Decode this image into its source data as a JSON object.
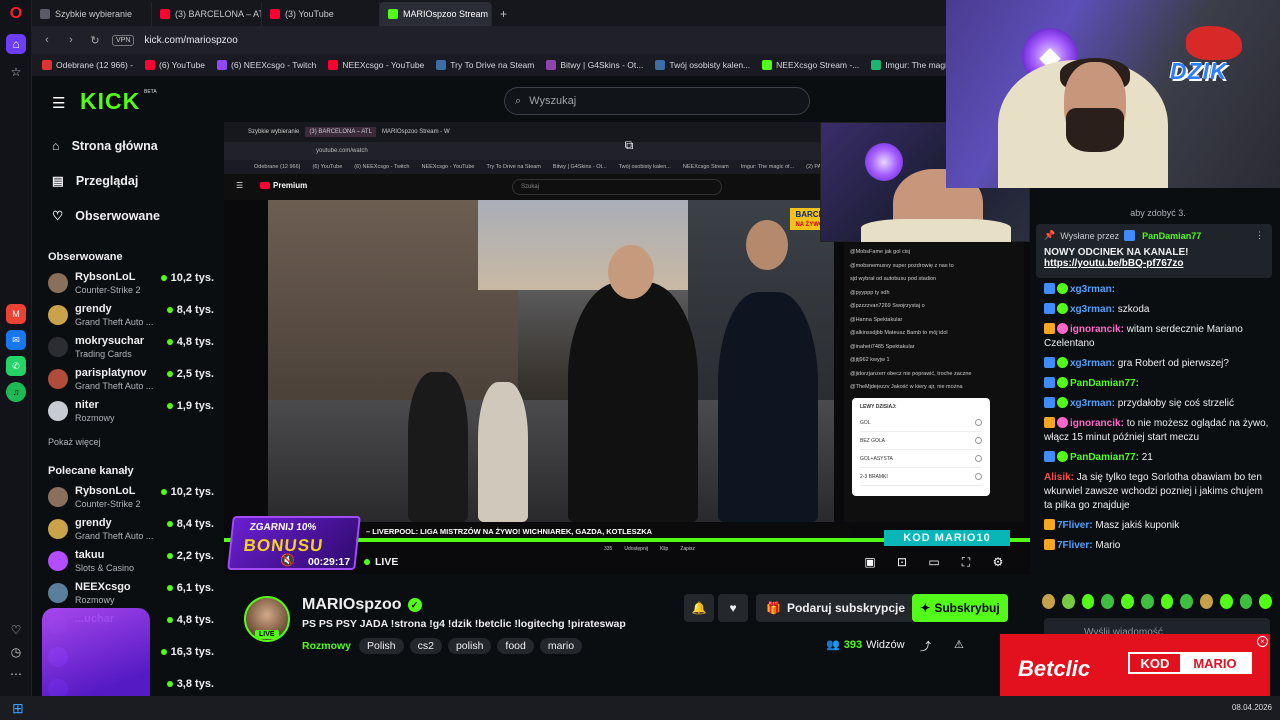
{
  "browser": {
    "tabs": [
      {
        "label": "Szybkie wybieranie",
        "color": "#5a5a66"
      },
      {
        "label": "(3) BARCELONA – ATL",
        "color": "#ff0033"
      },
      {
        "label": "(3) YouTube",
        "color": "#ff0033"
      },
      {
        "label": "MARIOspzoo Stream - W",
        "color": "#53fc18"
      }
    ],
    "new_tab": "+",
    "vpn": "VPN",
    "url": "kick.com/mariospzoo",
    "bookmarks": [
      {
        "label": "Odebrane (12 966) -",
        "color": "#d33"
      },
      {
        "label": "(6) YouTube",
        "color": "#ff0033"
      },
      {
        "label": "(6) NEEXcsgo - Twitch",
        "color": "#9146ff"
      },
      {
        "label": "NEEXcsgo - YouTube",
        "color": "#ff0033"
      },
      {
        "label": "Try To Drive na Steam",
        "color": "#3a6ea5"
      },
      {
        "label": "Bitwy | G4Skins - Ot...",
        "color": "#8e44ad"
      },
      {
        "label": "Twój osobisty kalen...",
        "color": "#3a6ea5"
      },
      {
        "label": "NEEXcsgo Stream -...",
        "color": "#53fc18"
      },
      {
        "label": "Imgur: The magic of...",
        "color": "#1bb76e"
      },
      {
        "label": "(2) PASI",
        "color": "#ff0033"
      }
    ]
  },
  "kick": {
    "logo": "KICK",
    "beta": "BETA",
    "search_placeholder": "Wyszukaj",
    "nav": [
      {
        "label": "Strona główna",
        "icon": "home-icon",
        "glyph": "⌂"
      },
      {
        "label": "Przeglądaj",
        "icon": "browse-icon",
        "glyph": "▤"
      },
      {
        "label": "Obserwowane",
        "icon": "heart-icon",
        "glyph": "♡"
      }
    ],
    "followed_title": "Obserwowane",
    "followed": [
      {
        "name": "RybsonLoL",
        "category": "Counter-Strike 2",
        "viewers": "10,2 tys.",
        "color": "#8a6f5c"
      },
      {
        "name": "grendy",
        "category": "Grand Theft Auto ...",
        "viewers": "8,4 tys.",
        "color": "#c9a24a"
      },
      {
        "name": "mokrysuchar",
        "category": "Trading Cards",
        "viewers": "4,8 tys.",
        "color": "#2b2d33"
      },
      {
        "name": "parisplatynov",
        "category": "Grand Theft Auto ...",
        "viewers": "2,5 tys.",
        "color": "#b04c3c"
      },
      {
        "name": "niter",
        "category": "Rozmowy",
        "viewers": "1,9 tys.",
        "color": "#c7ccd3"
      }
    ],
    "show_more": "Pokaż więcej",
    "recommended_title": "Polecane kanały",
    "recommended": [
      {
        "name": "RybsonLoL",
        "category": "Counter-Strike 2",
        "viewers": "10,2 tys.",
        "color": "#8a6f5c"
      },
      {
        "name": "grendy",
        "category": "Grand Theft Auto ...",
        "viewers": "8,4 tys.",
        "color": "#c9a24a"
      },
      {
        "name": "takuu",
        "category": "Slots & Casino",
        "viewers": "2,2 tys.",
        "color": "#b44cff"
      },
      {
        "name": "NEEXcsgo",
        "category": "Rozmowy",
        "viewers": "6,1 tys.",
        "color": "#5a7f9c"
      },
      {
        "name": "...uchar",
        "category": "",
        "viewers": "4,8 tys.",
        "color": "#2b2d33"
      },
      {
        "name": "",
        "category": "",
        "viewers": "16,3 tys.",
        "color": "#6a4fd1"
      },
      {
        "name": "",
        "category": "",
        "viewers": "3,8 tys.",
        "color": "#6a4fd1"
      }
    ]
  },
  "video": {
    "inner_tabs": [
      "Szybkie wybieranie",
      "(3) BARCELONA – ATL",
      "MARIOspzoo Stream - W"
    ],
    "inner_url": "youtube.com/watch",
    "inner_bookmarks": [
      "Odebrane (12 966)",
      "(6) YouTube",
      "(6) NEEXcsgo - Twitch",
      "NEEXcsgo - YouTube",
      "Try To Drive na Steam",
      "Bitwy | G4Skins - Ot...",
      "Twój osobisty kalen...",
      "NEEXcsgo Stream",
      "Imgur: The magic of...",
      "(2) PASI"
    ],
    "yt_premium": "Premium",
    "yt_search": "Szukaj",
    "barca_badge": "BARCELO",
    "barca_sub": "NA ŻYWO",
    "yt_chat": [
      "@MobsFame jak gol cisj",
      "@mobsnemusvy super pozdrowię z nas to",
      "sjd wybrał od autobusu pod stadion",
      "@pyyppp ty sdh",
      "@pzzzzvan7269 Swojrzystaj o",
      "@Hanna Spektakular",
      "@alkinssdjbb Mateusz Bamb to mój idol",
      "@inaheti7485 Spektakular",
      "@jtj962 kwyjw 1",
      "@jidorzjanzerr obecz nie poprawić, troche zaczne",
      "@TheMjdejezzv Jakość w kiery ajr, nie można"
    ],
    "poll_title": "LEWY DZISIAJ:",
    "poll_options": [
      "GOL",
      "BEZ GOLA",
      "GOL+ASYSTA",
      "2-3 BRAMKI"
    ],
    "ticker": "– LIVERPOOL: LIGA MISTRZÓW NA ŻYWO! WICHNIAREK, GAZDA, KOTLESZKA",
    "yt_controls": [
      "335",
      "Udostępnij",
      "Klip",
      "Zapisz"
    ],
    "promo_line1": "ZGARNIJ 10%",
    "promo_line2": "BONUSU",
    "kod_overlay": "KOD MARIO10",
    "timer": "00:29:17",
    "live": "LIVE"
  },
  "chat": {
    "top_text": "aby zdobyć 3.",
    "pinned_label": "Wysłane przez",
    "pinned_user": "PanDamian77",
    "pinned_message": "NOWY ODCINEK NA KANALE!",
    "pinned_link": "https://youtu.be/bBQ-pf767zo",
    "messages": [
      {
        "user": "xg3rman:",
        "text": "",
        "color": "#4ea3ff",
        "b1": "#3f8cff",
        "b2": "#53fc18"
      },
      {
        "user": "xg3rman:",
        "text": "szkoda",
        "color": "#4ea3ff",
        "b1": "#3f8cff",
        "b2": "#53fc18"
      },
      {
        "user": "ignorancik:",
        "text": "witam serdecznie Mariano Czelentano",
        "color": "#ff66cc",
        "b1": "#f5a623",
        "b2": "#ff66cc"
      },
      {
        "user": "xg3rman:",
        "text": "gra Robert od pierwszej?",
        "color": "#4ea3ff",
        "b1": "#3f8cff",
        "b2": "#53fc18"
      },
      {
        "user": "PanDamian77:",
        "text": "",
        "color": "#53fc18",
        "b1": "#3f8cff",
        "b2": "#53fc18"
      },
      {
        "user": "xg3rman:",
        "text": "przydałoby się coś strzelić",
        "color": "#4ea3ff",
        "b1": "#3f8cff",
        "b2": "#53fc18"
      },
      {
        "user": "ignorancik:",
        "text": "to nie możesz oglądać na żywo, włącz 15 minut później start meczu",
        "color": "#ff66cc",
        "b1": "#f5a623",
        "b2": "#ff66cc"
      },
      {
        "user": "PanDamian77:",
        "text": "21",
        "color": "#53fc18",
        "b1": "#3f8cff",
        "b2": "#53fc18"
      },
      {
        "user": "Alisik:",
        "text": "Ja się tylko tego Sorlotha obawiam bo ten wkurwiel zawsze wchodzi pozniej i jakims chujem ta pilka go znajduje",
        "color": "#ff4d4d",
        "b1": "",
        "b2": ""
      },
      {
        "user": "7Fliver:",
        "text": "Masz jakiś kuponik",
        "color": "#4ea3ff",
        "b1": "#f5a623",
        "b2": ""
      },
      {
        "user": "7Fliver:",
        "text": "Mario",
        "color": "#4ea3ff",
        "b1": "#f5a623",
        "b2": ""
      }
    ],
    "input_placeholder": "Wyślij wiadomość"
  },
  "stream": {
    "streamer": "MARIOspzoo",
    "title": "PS PS PSY JADA !strona !g4 !dzik !betclic !logitechg !pirateswap",
    "category": "Rozmowy",
    "tags": [
      "Polish",
      "cs2",
      "polish",
      "food",
      "mario"
    ],
    "live_badge": "LIVE",
    "gift_sub": "Podaruj subskrypcje",
    "subscribe": "Subskrybuj",
    "viewers": "393",
    "viewers_label": "Widzów"
  },
  "overlay": {
    "dzik": "DZIK",
    "betclic": "Betclic",
    "kod": "KOD",
    "mario": "MARIO"
  },
  "taskbar": {
    "date": "08.04.2026"
  }
}
